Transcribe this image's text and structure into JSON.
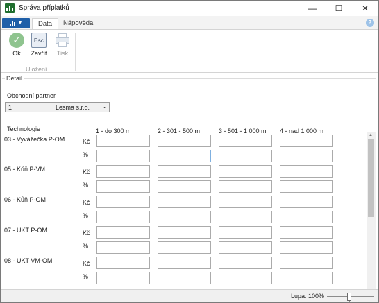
{
  "window": {
    "title": "Správa příplatků",
    "icon": "app-logo-icon",
    "controls": [
      "minimize-icon",
      "maximize-icon",
      "close-icon"
    ]
  },
  "ribbon": {
    "file_button": {
      "icon": "chart-bars-icon",
      "color": "#1f5fa8"
    },
    "tabs": [
      {
        "label": "Data",
        "active": true
      },
      {
        "label": "Nápověda",
        "active": false
      }
    ],
    "buttons": [
      {
        "label": "Ok",
        "icon": "check-icon",
        "enabled": true
      },
      {
        "label": "Zavřít",
        "icon": "esc-key-icon",
        "icon_text": "Esc",
        "enabled": true
      },
      {
        "label": "Tisk",
        "icon": "printer-icon",
        "enabled": false
      }
    ],
    "group_label": "Uložení"
  },
  "detail": {
    "section_title": "Detail",
    "partner": {
      "label": "Obchodní partner",
      "code": "1",
      "name": "Lesma s.r.o."
    },
    "technology_header": "Technologie",
    "columns": [
      "1  -  do 300 m",
      "2  -  301 - 500 m",
      "3  -  501 - 1 000 m",
      "4  -  nad 1 000 m"
    ],
    "row_labels": [
      "Kč",
      "%"
    ],
    "technologies": [
      {
        "name": "03  -  Vyvážečka P-OM"
      },
      {
        "name": "05  -  Kůň P-VM"
      },
      {
        "name": "06  -  Kůň P-OM"
      },
      {
        "name": "07  -  UKT P-OM"
      },
      {
        "name": "08  -  UKT VM-OM"
      }
    ]
  },
  "status": {
    "zoom_label": "Lupa: 100%",
    "zoom_value": 100
  },
  "colors": {
    "accent": "#1f5fa8",
    "ok_green": "#8fc48f",
    "logo_green": "#1f6e2e"
  }
}
